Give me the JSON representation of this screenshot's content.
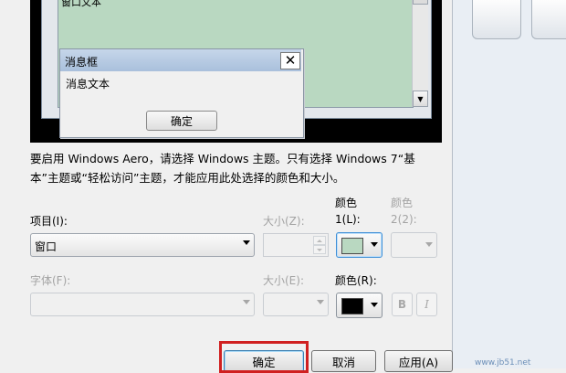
{
  "preview": {
    "window_text": "窗口文本",
    "message_box": {
      "title": "消息框",
      "text": "消息文本",
      "ok_label": "确定"
    }
  },
  "info_text": "要启用 Windows Aero，请选择 Windows 主题。只有选择 Windows 7“基本”主题或“轻松访问”主题，才能应用此处选择的颜色和大小。",
  "item": {
    "label": "项目(I):",
    "value": "窗口"
  },
  "size1_label": "大小(Z):",
  "color1_label_a": "颜色",
  "color1_label_b": "1(L):",
  "color1_value": "#b9d8c1",
  "color2_label_a": "颜色",
  "color2_label_b": "2(2):",
  "font": {
    "label": "字体(F):"
  },
  "size2_label": "大小(E):",
  "font_color_label": "颜色(R):",
  "font_color_value": "#000000",
  "bold_label": "B",
  "italic_label": "I",
  "buttons": {
    "ok": "确定",
    "cancel": "取消",
    "apply": "应用(A)"
  },
  "watermark": "www.jb51.net"
}
